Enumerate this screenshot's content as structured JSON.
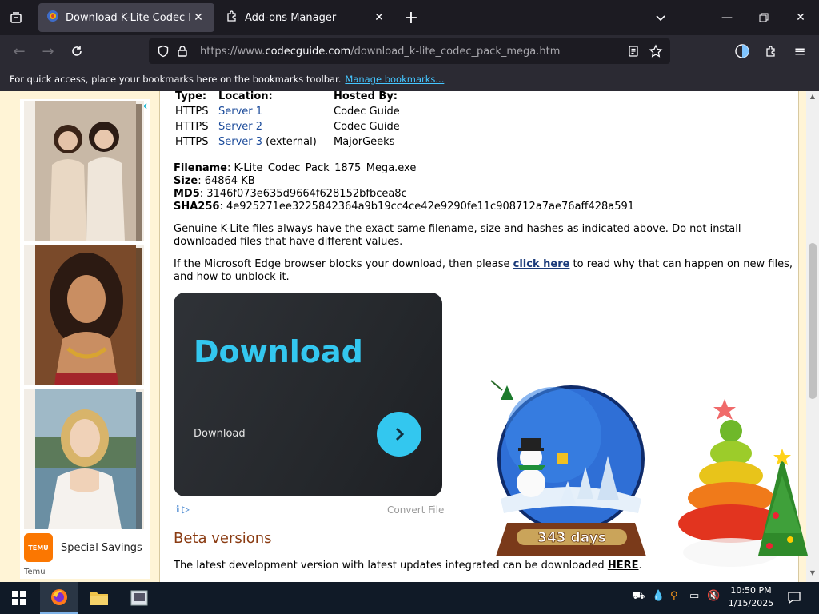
{
  "browser": {
    "tabs": [
      {
        "title": "Download K-Lite Codec Pack M",
        "active": true
      },
      {
        "title": "Add-ons Manager",
        "active": false
      }
    ],
    "url": {
      "scheme": "https://www.",
      "host": "codecguide.com",
      "path": "/download_k-lite_codec_pack_mega.htm"
    },
    "bookmarks_bar": {
      "text": "For quick access, place your bookmarks here on the bookmarks toolbar.",
      "link": "Manage bookmarks..."
    }
  },
  "ad": {
    "cta": "Special Savings",
    "brand_logo": "TEMU",
    "footer": "Temu"
  },
  "mirrors": {
    "headers": {
      "type": "Type:",
      "location": "Location:",
      "hosted_by": "Hosted By:"
    },
    "rows": [
      {
        "type": "HTTPS",
        "location": "Server 1",
        "suffix": "",
        "hosted_by": "Codec Guide"
      },
      {
        "type": "HTTPS",
        "location": "Server 2",
        "suffix": "",
        "hosted_by": "Codec Guide"
      },
      {
        "type": "HTTPS",
        "location": "Server 3",
        "suffix": " (external)",
        "hosted_by": "MajorGeeks"
      }
    ]
  },
  "file_info": {
    "filename_label": "Filename",
    "filename": ": K-Lite_Codec_Pack_1875_Mega.exe",
    "size_label": "Size",
    "size": ": 64864 KB",
    "md5_label": "MD5",
    "md5": ": 3146f073e635d9664f628152bfbcea8c",
    "sha256_label": "SHA256",
    "sha256": ": 4e925271ee3225842364a9b19cc4ce42e9290fe11c908712a7ae76aff428a591"
  },
  "notes": {
    "genuine": "Genuine K-Lite files always have the exact same filename, size and hashes as indicated above. Do not install downloaded files that have different values.",
    "edge_pre": "If the Microsoft Edge browser blocks your download, then please ",
    "edge_link": "click here",
    "edge_post": " to read why that can happen on new files, and how to unblock it."
  },
  "download_widget": {
    "title": "Download",
    "subtitle": "Download",
    "convert": "Convert File"
  },
  "beta": {
    "heading": "Beta versions",
    "text_pre": "The latest development version with latest updates integrated can be downloaded ",
    "link": "HERE",
    "text_post": "."
  },
  "countdown": {
    "days_label": "343 days"
  },
  "taskbar": {
    "time": "10:50 PM",
    "date": "1/15/2025"
  },
  "colors": {
    "accent": "#33c7ef",
    "heading": "#8a3b12",
    "link": "#1a4a9a"
  }
}
